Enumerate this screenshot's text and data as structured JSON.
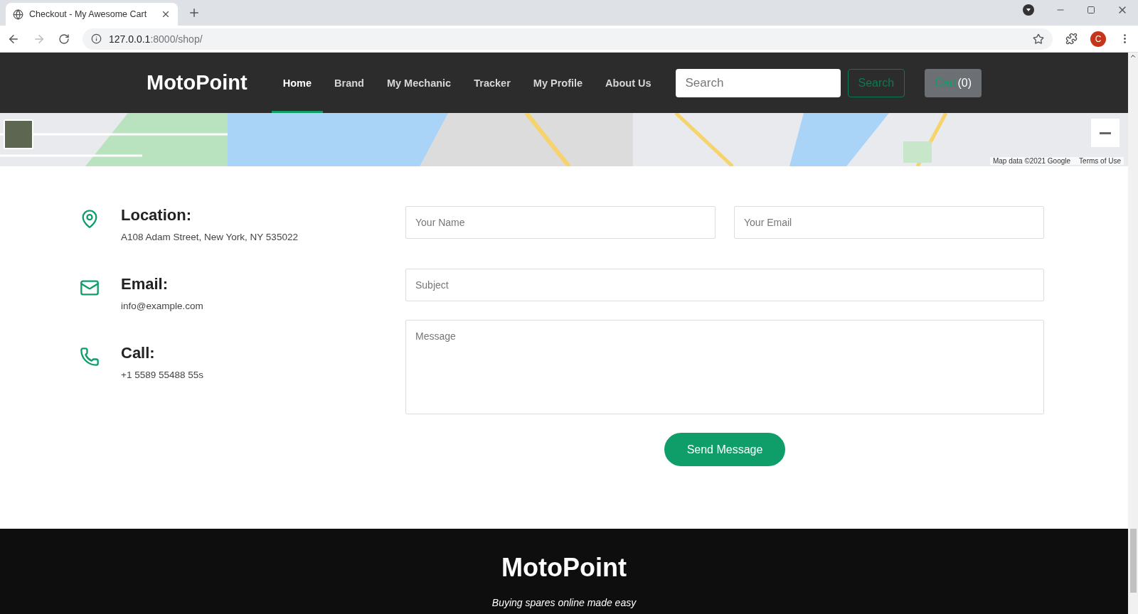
{
  "browser": {
    "tab_title": "Checkout - My Awesome Cart",
    "url_host": "127.0.0.1",
    "url_path": ":8000/shop/",
    "profile_initial": "C"
  },
  "navbar": {
    "brand": "MotoPoint",
    "links": [
      {
        "label": "Home",
        "selected": true
      },
      {
        "label": "Brand",
        "selected": false
      },
      {
        "label": "My Mechanic",
        "selected": false
      },
      {
        "label": "Tracker",
        "selected": false
      },
      {
        "label": "My Profile",
        "selected": false
      },
      {
        "label": "About Us",
        "selected": false
      }
    ],
    "search": {
      "placeholder": "Search"
    },
    "search_button": "Search",
    "cart": {
      "label": "Cart",
      "count": "(0)"
    }
  },
  "map": {
    "kind": "picture",
    "attribution": "Map data ©2021 Google",
    "terms": "Terms of Use"
  },
  "contact_info": [
    {
      "kind": "location",
      "heading": "Location:",
      "text": "A108 Adam Street, New York, NY 535022"
    },
    {
      "kind": "email",
      "heading": "Email:",
      "text": "info@example.com"
    },
    {
      "kind": "phone",
      "heading": "Call:",
      "text": "+1 5589 55488 55s"
    }
  ],
  "form": {
    "name_placeholder": "Your Name",
    "email_placeholder": "Your Email",
    "subject_placeholder": "Subject",
    "message_placeholder": "Message",
    "submit": "Send Message"
  },
  "footer": {
    "brand": "MotoPoint",
    "tagline": "Buying spares online made easy"
  }
}
